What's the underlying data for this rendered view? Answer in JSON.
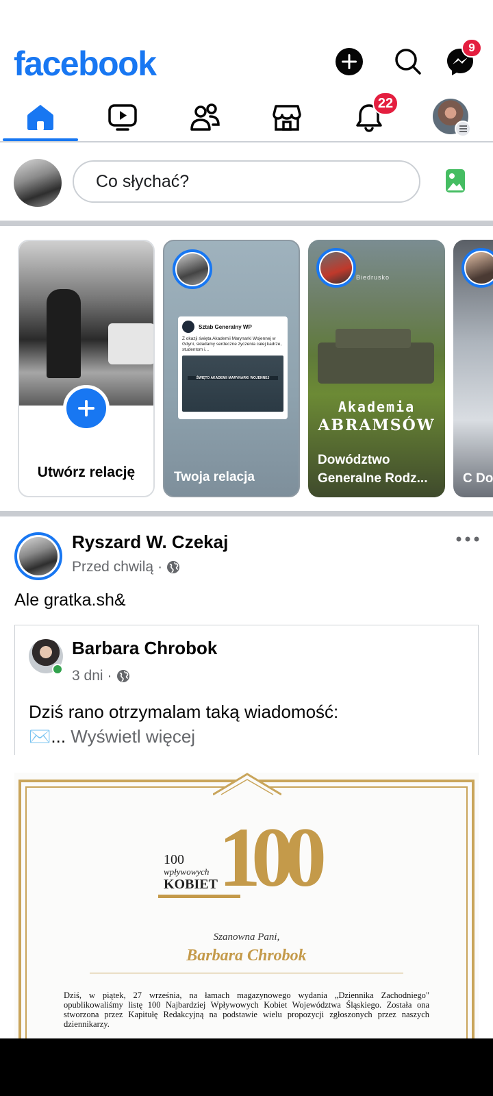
{
  "app": {
    "logo": "facebook"
  },
  "header": {
    "create_icon": "plus-circle-icon",
    "search_icon": "search-icon",
    "messenger_icon": "messenger-icon",
    "messenger_badge": "9"
  },
  "nav": {
    "tabs": [
      {
        "name": "home",
        "icon": "home-icon",
        "active": true
      },
      {
        "name": "video",
        "icon": "video-icon"
      },
      {
        "name": "friends",
        "icon": "friends-icon"
      },
      {
        "name": "marketplace",
        "icon": "marketplace-icon"
      },
      {
        "name": "notifications",
        "icon": "bell-icon",
        "badge": "22"
      },
      {
        "name": "menu",
        "icon": "profile-menu-icon"
      }
    ]
  },
  "composer": {
    "placeholder": "Co słychać?",
    "photo_icon": "photo-icon"
  },
  "stories": [
    {
      "label": "Utwórz relację",
      "type": "create"
    },
    {
      "label": "Twoja relacja",
      "type": "own",
      "preview_title": "Sztab Generalny WP",
      "preview_text": "Z okazji święta Akademii Marynarki Wojennej w Gdyni, składamy serdeczne życzenia całej kadrze, studentom i...",
      "preview_banner": "ŚWIĘTO AKADEMII MARYNARKI WOJENNEJ"
    },
    {
      "label": "Dowództwo Generalne Rodz...",
      "type": "page",
      "overlay_line1": "Akademia",
      "overlay_line2": "ABRAMSÓW",
      "overlay_top": "Biedrusko"
    },
    {
      "label": "C Do",
      "type": "page"
    }
  ],
  "post": {
    "author": "Ryszard W. Czekaj",
    "time": "Przed chwilą",
    "audience_icon": "globe-icon",
    "more_icon": "more-dots-icon",
    "text": "Ale gratka.sh&",
    "shared": {
      "author": "Barbara Chrobok",
      "time": "3 dni",
      "audience_icon": "globe-icon",
      "text": "Dziś rano otrzymalam taką wiadomość:",
      "text2_prefix": "✉️...",
      "see_more": "Wyświetl więcej"
    },
    "image": {
      "logo_small1": "100",
      "logo_small2": "wpływowych",
      "logo_small3": "KOBIET",
      "logo_big": "100",
      "greeting": "Szanowna Pani,",
      "recipient": "Barbara Chrobok",
      "body": "Dziś, w piątek, 27 września, na łamach magazynowego wydania „Dziennika Zachodniego\" opublikowaliśmy listę 100 Najbardziej Wpływowych Kobiet Województwa Śląskiego. Została ona stworzona przez Kapitułę Redakcyjną na podstawie wielu propozycji zgłoszonych przez naszych dziennikarzy."
    }
  },
  "colors": {
    "brand": "#1877f2",
    "badge": "#e41e3f",
    "secondary_text": "#65676b",
    "gold": "#c49a4a"
  }
}
